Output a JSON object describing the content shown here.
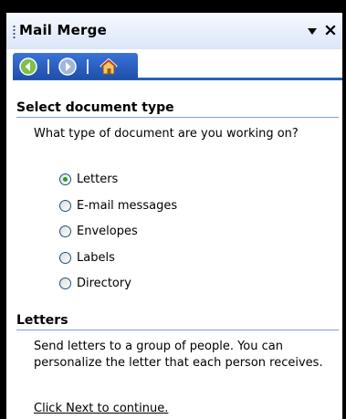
{
  "panel": {
    "title": "Mail Merge"
  },
  "nav": {
    "back_icon": "back-arrow-icon",
    "forward_icon": "forward-arrow-icon",
    "home_icon": "home-icon"
  },
  "select_type": {
    "heading": "Select document type",
    "question": "What type of document are you working on?",
    "options": [
      {
        "label": "Letters",
        "selected": true
      },
      {
        "label": "E-mail messages",
        "selected": false
      },
      {
        "label": "Envelopes",
        "selected": false
      },
      {
        "label": "Labels",
        "selected": false
      },
      {
        "label": "Directory",
        "selected": false
      }
    ]
  },
  "letters": {
    "heading": "Letters",
    "description": "Send letters to a group of people. You can personalize the letter that each person receives.",
    "next_hint": "Click Next to continue."
  },
  "colors": {
    "title_bar_start": "#f6f9ff",
    "title_bar_end": "#dbe6f8",
    "nav_bar": "#2a5fc2",
    "radio_selected_dot": "#21a121",
    "section_rule": "#7f9fd6"
  }
}
